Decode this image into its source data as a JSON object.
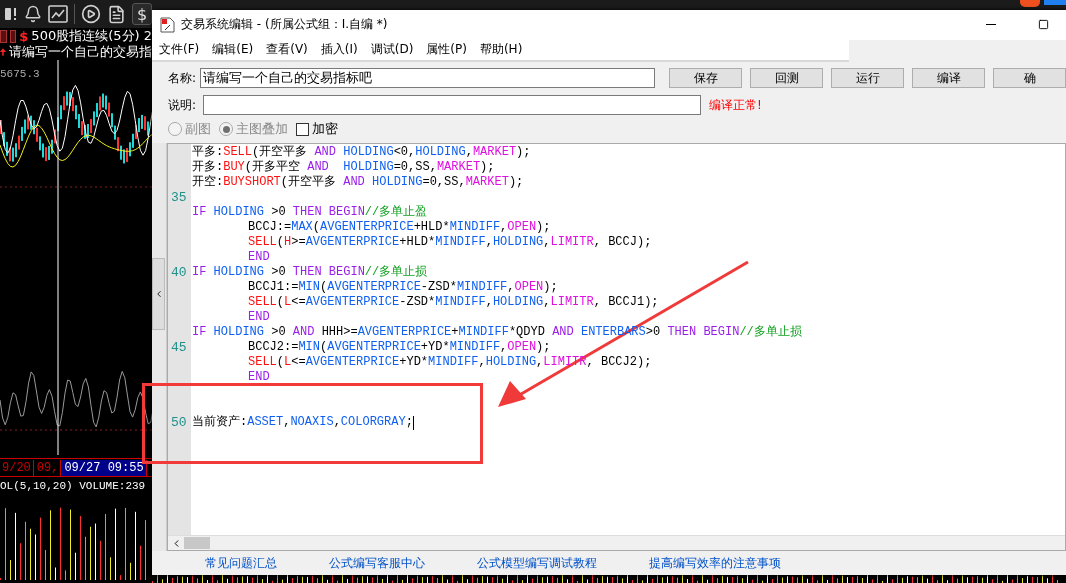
{
  "toolbar": {
    "currency_button": "$"
  },
  "chart": {
    "symbol": "$",
    "title": "500股指连续(5分) 2",
    "indicator": "请编写一个自己的交易指",
    "price_label": "5675.3",
    "dates": [
      {
        "text": "9/20",
        "selected": false
      },
      {
        "text": "09,",
        "selected": false
      },
      {
        "text": "09/27 09:55",
        "selected": true
      }
    ],
    "volume_label": "OL(5,10,20) VOLUME:239"
  },
  "window": {
    "title": "交易系统编辑 - (所属公式组：I.自编 *)",
    "menu": [
      "文件(F)",
      "编辑(E)",
      "查看(V)",
      "插入(I)",
      "调试(D)",
      "属性(P)",
      "帮助(H)"
    ],
    "name_label": "名称:",
    "name_value": "请编写一个自己的交易指标吧",
    "description_label": "说明:",
    "buttons": [
      "保存",
      "回测",
      "运行",
      "编译",
      "确"
    ],
    "status": "编译正常!",
    "options": [
      {
        "kind": "radio",
        "label": "副图",
        "selected": false,
        "disabled": true
      },
      {
        "kind": "radio",
        "label": "主图叠加",
        "selected": true,
        "disabled": true
      },
      {
        "kind": "checkbox",
        "label": "加密",
        "checked": false
      }
    ],
    "editor": {
      "lines": [
        {
          "tokens": [
            {
              "kind": "plain",
              "text": "平多:"
            },
            {
              "kind": "func",
              "text": "SELL"
            },
            {
              "kind": "plain",
              "text": "(开空平多 "
            },
            {
              "kind": "keyword",
              "text": "AND "
            },
            {
              "kind": "ident",
              "text": "HOLDING"
            },
            {
              "kind": "plain",
              "text": "<0,"
            },
            {
              "kind": "ident",
              "text": "HOLDING"
            },
            {
              "kind": "plain",
              "text": ","
            },
            {
              "kind": "const",
              "text": "MARKET"
            },
            {
              "kind": "plain",
              "text": ");"
            }
          ]
        },
        {
          "tokens": [
            {
              "kind": "plain",
              "text": "开多:"
            },
            {
              "kind": "func",
              "text": "BUY"
            },
            {
              "kind": "plain",
              "text": "(开多平空 "
            },
            {
              "kind": "keyword",
              "text": "AND  "
            },
            {
              "kind": "ident",
              "text": "HOLDING"
            },
            {
              "kind": "plain",
              "text": "=0,SS,"
            },
            {
              "kind": "const",
              "text": "MARKET"
            },
            {
              "kind": "plain",
              "text": ");"
            }
          ]
        },
        {
          "tokens": [
            {
              "kind": "plain",
              "text": "开空:"
            },
            {
              "kind": "func",
              "text": "BUYSHORT"
            },
            {
              "kind": "plain",
              "text": "(开空平多 "
            },
            {
              "kind": "keyword",
              "text": "AND "
            },
            {
              "kind": "ident",
              "text": "HOLDING"
            },
            {
              "kind": "plain",
              "text": "=0,SS,"
            },
            {
              "kind": "const",
              "text": "MARKET"
            },
            {
              "kind": "plain",
              "text": ");"
            }
          ]
        },
        {
          "kind": "blank",
          "number": "35"
        },
        {
          "tokens": [
            {
              "kind": "keyword",
              "text": "IF "
            },
            {
              "kind": "ident",
              "text": "HOLDING"
            },
            {
              "kind": "plain",
              "text": " >0 "
            },
            {
              "kind": "keyword",
              "text": "THEN BEGIN"
            },
            {
              "kind": "comment",
              "text": "//多单止盈"
            }
          ]
        },
        {
          "indent": true,
          "tokens": [
            {
              "kind": "plain",
              "text": "BCCJ:="
            },
            {
              "kind": "ident",
              "text": "MAX"
            },
            {
              "kind": "plain",
              "text": "("
            },
            {
              "kind": "ident",
              "text": "AVGENTERPRICE"
            },
            {
              "kind": "plain",
              "text": "+HLD*"
            },
            {
              "kind": "ident",
              "text": "MINDIFF"
            },
            {
              "kind": "plain",
              "text": ","
            },
            {
              "kind": "const",
              "text": "OPEN"
            },
            {
              "kind": "plain",
              "text": ");"
            }
          ]
        },
        {
          "indent": true,
          "tokens": [
            {
              "kind": "func",
              "text": "SELL"
            },
            {
              "kind": "plain",
              "text": "("
            },
            {
              "kind": "func",
              "text": "H"
            },
            {
              "kind": "plain",
              "text": ">="
            },
            {
              "kind": "ident",
              "text": "AVGENTERPRICE"
            },
            {
              "kind": "plain",
              "text": "+HLD*"
            },
            {
              "kind": "ident",
              "text": "MINDIFF"
            },
            {
              "kind": "plain",
              "text": ","
            },
            {
              "kind": "ident",
              "text": "HOLDING"
            },
            {
              "kind": "plain",
              "text": ","
            },
            {
              "kind": "const",
              "text": "LIMITR"
            },
            {
              "kind": "plain",
              "text": ", BCCJ);"
            }
          ]
        },
        {
          "indent": true,
          "tokens": [
            {
              "kind": "keyword",
              "text": "END"
            }
          ]
        },
        {
          "number": "40",
          "tokens": [
            {
              "kind": "keyword",
              "text": "IF "
            },
            {
              "kind": "ident",
              "text": "HOLDING"
            },
            {
              "kind": "plain",
              "text": " >0 "
            },
            {
              "kind": "keyword",
              "text": "THEN BEGIN"
            },
            {
              "kind": "comment",
              "text": "//多单止损"
            }
          ]
        },
        {
          "indent": true,
          "tokens": [
            {
              "kind": "plain",
              "text": "BCCJ1:="
            },
            {
              "kind": "ident",
              "text": "MIN"
            },
            {
              "kind": "plain",
              "text": "("
            },
            {
              "kind": "ident",
              "text": "AVGENTERPRICE"
            },
            {
              "kind": "plain",
              "text": "-ZSD*"
            },
            {
              "kind": "ident",
              "text": "MINDIFF"
            },
            {
              "kind": "plain",
              "text": ","
            },
            {
              "kind": "const",
              "text": "OPEN"
            },
            {
              "kind": "plain",
              "text": ");"
            }
          ]
        },
        {
          "indent": true,
          "tokens": [
            {
              "kind": "func",
              "text": "SELL"
            },
            {
              "kind": "plain",
              "text": "("
            },
            {
              "kind": "func",
              "text": "L"
            },
            {
              "kind": "plain",
              "text": "<="
            },
            {
              "kind": "ident",
              "text": "AVGENTERPRICE"
            },
            {
              "kind": "plain",
              "text": "-ZSD*"
            },
            {
              "kind": "ident",
              "text": "MINDIFF"
            },
            {
              "kind": "plain",
              "text": ","
            },
            {
              "kind": "ident",
              "text": "HOLDING"
            },
            {
              "kind": "plain",
              "text": ","
            },
            {
              "kind": "const",
              "text": "LIMITR"
            },
            {
              "kind": "plain",
              "text": ", BCCJ1);"
            }
          ]
        },
        {
          "indent": true,
          "tokens": [
            {
              "kind": "keyword",
              "text": "END"
            }
          ]
        },
        {
          "tokens": [
            {
              "kind": "keyword",
              "text": "IF "
            },
            {
              "kind": "ident",
              "text": "HOLDING"
            },
            {
              "kind": "plain",
              "text": " >0 "
            },
            {
              "kind": "keyword",
              "text": "AND "
            },
            {
              "kind": "plain",
              "text": "HHH>="
            },
            {
              "kind": "ident",
              "text": "AVGENTERPRICE"
            },
            {
              "kind": "plain",
              "text": "+"
            },
            {
              "kind": "ident",
              "text": "MINDIFF"
            },
            {
              "kind": "plain",
              "text": "*QDYD "
            },
            {
              "kind": "keyword",
              "text": "AND "
            },
            {
              "kind": "ident",
              "text": "ENTERBARS"
            },
            {
              "kind": "plain",
              "text": ">0 "
            },
            {
              "kind": "keyword",
              "text": "THEN BEGIN"
            },
            {
              "kind": "comment",
              "text": "//多单止损"
            }
          ]
        },
        {
          "number": "45",
          "indent": true,
          "tokens": [
            {
              "kind": "plain",
              "text": "BCCJ2:="
            },
            {
              "kind": "ident",
              "text": "MIN"
            },
            {
              "kind": "plain",
              "text": "("
            },
            {
              "kind": "ident",
              "text": "AVGENTERPRICE"
            },
            {
              "kind": "plain",
              "text": "+YD*"
            },
            {
              "kind": "ident",
              "text": "MINDIFF"
            },
            {
              "kind": "plain",
              "text": ","
            },
            {
              "kind": "const",
              "text": "OPEN"
            },
            {
              "kind": "plain",
              "text": ");"
            }
          ]
        },
        {
          "indent": true,
          "tokens": [
            {
              "kind": "func",
              "text": "SELL"
            },
            {
              "kind": "plain",
              "text": "("
            },
            {
              "kind": "func",
              "text": "L"
            },
            {
              "kind": "plain",
              "text": "<="
            },
            {
              "kind": "ident",
              "text": "AVGENTERPRICE"
            },
            {
              "kind": "plain",
              "text": "+YD*"
            },
            {
              "kind": "ident",
              "text": "MINDIFF"
            },
            {
              "kind": "plain",
              "text": ","
            },
            {
              "kind": "ident",
              "text": "HOLDING"
            },
            {
              "kind": "plain",
              "text": ","
            },
            {
              "kind": "const",
              "text": "LIMITR"
            },
            {
              "kind": "plain",
              "text": ", BCCJ2);"
            }
          ]
        },
        {
          "indent": true,
          "tokens": [
            {
              "kind": "keyword",
              "text": "END"
            }
          ]
        },
        {
          "kind": "blank"
        },
        {
          "kind": "blank"
        },
        {
          "number": "50",
          "cursor": true,
          "tokens": [
            {
              "kind": "plain",
              "text": "当前资产:"
            },
            {
              "kind": "ident",
              "text": "ASSET"
            },
            {
              "kind": "plain",
              "text": ","
            },
            {
              "kind": "ident",
              "text": "NOAXIS"
            },
            {
              "kind": "plain",
              "text": ","
            },
            {
              "kind": "ident",
              "text": "COLORGRAY"
            },
            {
              "kind": "plain",
              "text": ";"
            }
          ]
        }
      ]
    },
    "links": [
      "常见问题汇总",
      "公式编写客服中心",
      "公式模型编写调试教程",
      "提高编写效率的注意事项"
    ]
  }
}
